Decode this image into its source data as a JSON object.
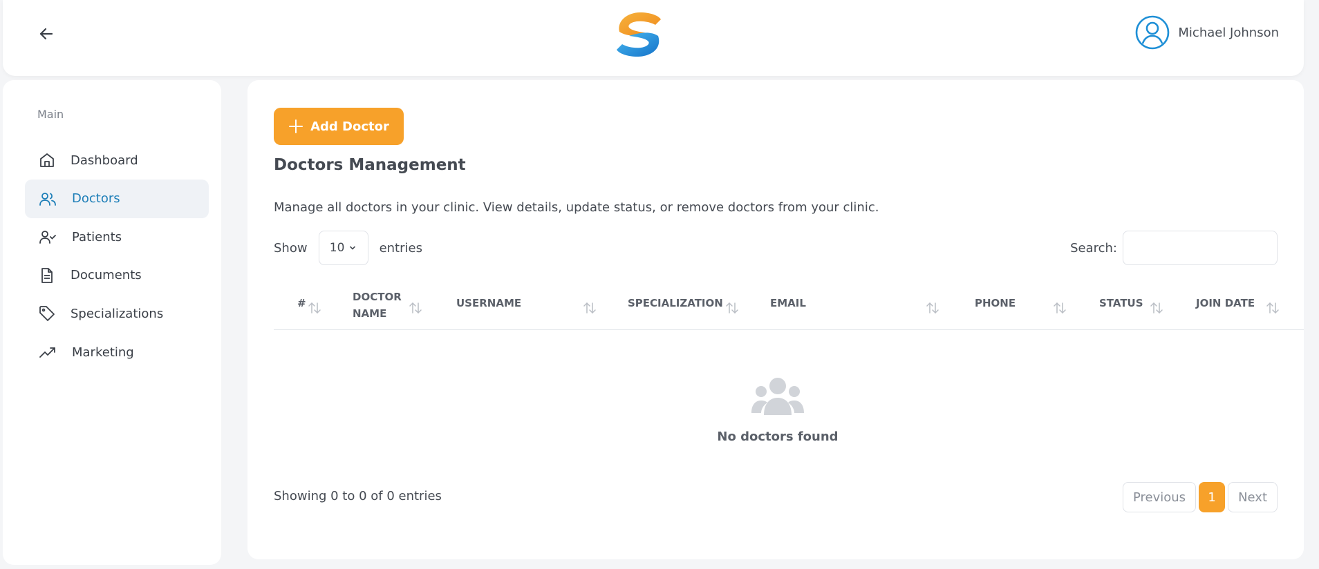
{
  "header": {
    "user_name": "Michael Johnson"
  },
  "sidebar": {
    "section_label": "Main",
    "items": [
      {
        "label": "Dashboard",
        "icon": "home-icon"
      },
      {
        "label": "Doctors",
        "icon": "users-icon",
        "active": true
      },
      {
        "label": "Patients",
        "icon": "user-check-icon"
      },
      {
        "label": "Documents",
        "icon": "file-text-icon"
      },
      {
        "label": "Specializations",
        "icon": "tag-icon"
      },
      {
        "label": "Marketing",
        "icon": "trending-up-icon"
      }
    ]
  },
  "main": {
    "add_button_label": "Add Doctor",
    "title": "Doctors Management",
    "description": "Manage all doctors in your clinic. View details, update status, or remove doctors from your clinic.",
    "show_label": "Show",
    "entries_value": "10",
    "entries_label": "entries",
    "search_label": "Search:",
    "search_value": "",
    "columns": [
      "#",
      "DOCTOR NAME",
      "USERNAME",
      "SPECIALIZATION",
      "EMAIL",
      "PHONE",
      "STATUS",
      "JOIN DATE"
    ],
    "empty_message": "No doctors found",
    "showing_text": "Showing 0 to 0 of 0 entries",
    "pagination": {
      "previous_label": "Previous",
      "current_page": "1",
      "next_label": "Next"
    }
  },
  "colors": {
    "accent": "#f7a12a",
    "active_nav": "#1e7fb8",
    "logo_blue": "#1e8fd6"
  }
}
